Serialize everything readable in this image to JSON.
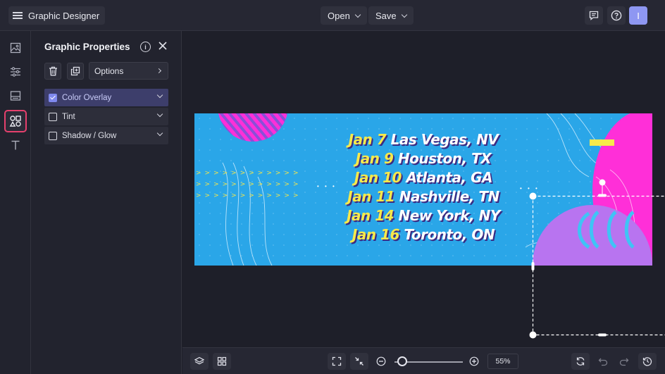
{
  "header": {
    "app_title": "Graphic Designer",
    "open_label": "Open",
    "save_label": "Save",
    "avatar_initial": "I"
  },
  "rail": {
    "items": [
      "image-icon",
      "adjust-sliders-icon",
      "layout-icon",
      "graphics-shapes-icon",
      "text-icon"
    ],
    "active": "graphics-shapes-icon",
    "active_color": "#e5406d"
  },
  "panel": {
    "title": "Graphic Properties",
    "options_label": "Options",
    "properties": [
      {
        "label": "Color Overlay",
        "checked": true
      },
      {
        "label": "Tint",
        "checked": false
      },
      {
        "label": "Shadow / Glow",
        "checked": false
      }
    ]
  },
  "canvas": {
    "background_color": "#2aa6e8",
    "accent_colors": [
      "#f7e94a",
      "#ff2fd8",
      "#b874f0"
    ],
    "lines": [
      {
        "date": "Jan 7",
        "city": "Las Vegas, NV"
      },
      {
        "date": "Jan 9",
        "city": "Houston, TX"
      },
      {
        "date": "Jan 10",
        "city": "Atlanta, GA"
      },
      {
        "date": "Jan 11",
        "city": "Nashville, TN"
      },
      {
        "date": "Jan 14",
        "city": "New York, NY"
      },
      {
        "date": "Jan 16",
        "city": "Toronto, ON"
      }
    ]
  },
  "footer": {
    "zoom_label": "55%",
    "zoom_fraction": 0.55
  }
}
